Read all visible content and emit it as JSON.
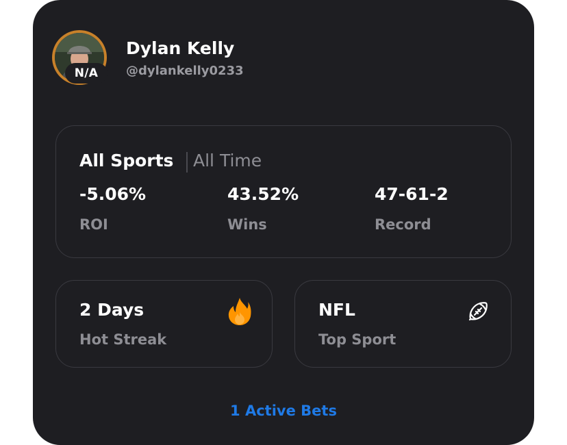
{
  "profile": {
    "name": "Dylan Kelly",
    "handle": "@dylankelly0233",
    "badge": "N/A",
    "avatar_ring_color": "#c8812a"
  },
  "filters": {
    "sport": "All Sports",
    "timeframe": "All Time"
  },
  "stats": [
    {
      "value": "-5.06%",
      "label": "ROI"
    },
    {
      "value": "43.52%",
      "label": "Wins"
    },
    {
      "value": "47-61-2",
      "label": "Record"
    }
  ],
  "streak": {
    "value": "2 Days",
    "label": "Hot Streak",
    "icon": "fire-icon"
  },
  "top_sport": {
    "value": "NFL",
    "label": "Top Sport",
    "icon": "football-icon"
  },
  "active_bets_link": "1 Active Bets",
  "colors": {
    "background": "#1e1e22",
    "accent": "#1f7ae6",
    "fire": "#ff9500"
  }
}
